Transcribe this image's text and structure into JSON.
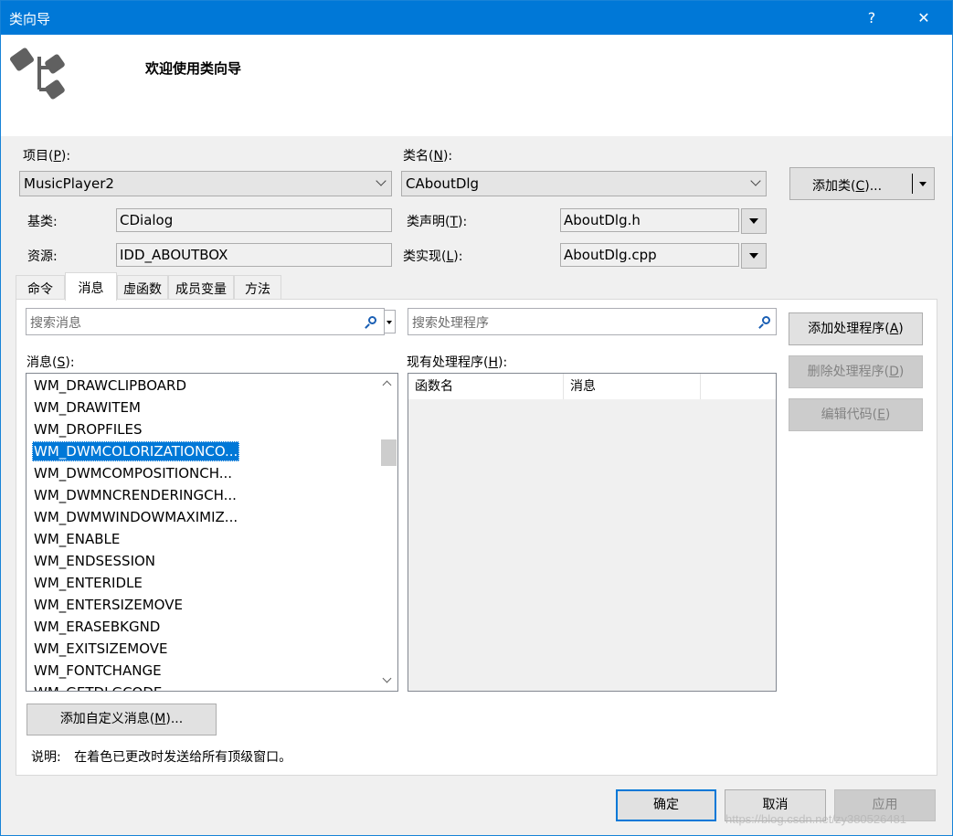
{
  "window": {
    "title": "类向导",
    "help_glyph": "?",
    "close_glyph": "✕"
  },
  "banner": {
    "welcome": "欢迎使用类向导",
    "logo_icon": "class-wizard-icon"
  },
  "project": {
    "label": "项目(",
    "hotkey": "P",
    "label_end": "):",
    "value": "MusicPlayer2"
  },
  "classname": {
    "label": "类名(",
    "hotkey": "N",
    "label_end": "):",
    "value": "CAboutDlg"
  },
  "add_class": {
    "label": "添加类(",
    "hotkey": "C",
    "label_end": ")..."
  },
  "base_class": {
    "label": "基类:",
    "value": "CDialog"
  },
  "resource": {
    "label": "资源:",
    "value": "IDD_ABOUTBOX"
  },
  "class_decl": {
    "label": "类声明(",
    "hotkey": "T",
    "label_end": "):",
    "value": "AboutDlg.h"
  },
  "class_impl": {
    "label": "类实现(",
    "hotkey": "L",
    "label_end": "):",
    "value": "AboutDlg.cpp"
  },
  "tabs": [
    {
      "label": "命令"
    },
    {
      "label": "消息"
    },
    {
      "label": "虚函数"
    },
    {
      "label": "成员变量"
    },
    {
      "label": "方法"
    }
  ],
  "active_tab": "消息",
  "search_messages": {
    "placeholder": "搜索消息"
  },
  "search_handlers": {
    "placeholder": "搜索处理程序"
  },
  "messages": {
    "label": "消息(",
    "hotkey": "S",
    "label_end": "):",
    "items": [
      "WM_DRAWCLIPBOARD",
      "WM_DRAWITEM",
      "WM_DROPFILES",
      "WM_DWMCOLORIZATIONCO...",
      "WM_DWMCOMPOSITIONCH...",
      "WM_DWMNCRENDERINGCH...",
      "WM_DWMWINDOWMAXIMIZ...",
      "WM_ENABLE",
      "WM_ENDSESSION",
      "WM_ENTERIDLE",
      "WM_ENTERSIZEMOVE",
      "WM_ERASEBKGND",
      "WM_EXITSIZEMOVE",
      "WM_FONTCHANGE",
      "WM_GETDLGCODE"
    ],
    "selected_index": 3
  },
  "handlers": {
    "label": "现有处理程序(",
    "hotkey": "H",
    "label_end": "):",
    "columns": [
      "函数名",
      "消息",
      ""
    ]
  },
  "side_buttons": {
    "add_handler": {
      "label": "添加处理程序(",
      "hotkey": "A",
      "label_end": ")"
    },
    "delete_handler": {
      "label": "删除处理程序(",
      "hotkey": "D",
      "label_end": ")"
    },
    "edit_code": {
      "label": "编辑代码(",
      "hotkey": "E",
      "label_end": ")"
    }
  },
  "add_custom": {
    "label": "添加自定义消息(",
    "hotkey": "M",
    "label_end": ")..."
  },
  "description": {
    "label": "说明:",
    "text": "在着色已更改时发送给所有顶级窗口。"
  },
  "footer": {
    "ok": "确定",
    "cancel": "取消",
    "apply": "应用"
  },
  "watermark": "https://blog.csdn.net/zy3805264​81",
  "colors": {
    "accent": "#0078d7",
    "disabled_text": "#838383"
  }
}
